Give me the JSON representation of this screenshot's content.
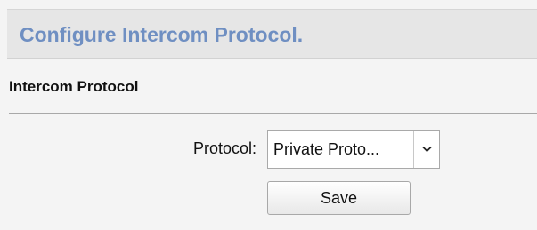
{
  "header": {
    "title": "Configure Intercom Protocol."
  },
  "section": {
    "title": "Intercom Protocol"
  },
  "form": {
    "protocol_label": "Protocol:",
    "protocol_value": "Private Proto...",
    "protocol_dropdown_icon": "chevron-down-icon",
    "save_label": "Save"
  },
  "colors": {
    "title_text": "#6f8fc2",
    "title_bar_background": "#e6e6e6",
    "page_background": "#f4f4f4"
  }
}
